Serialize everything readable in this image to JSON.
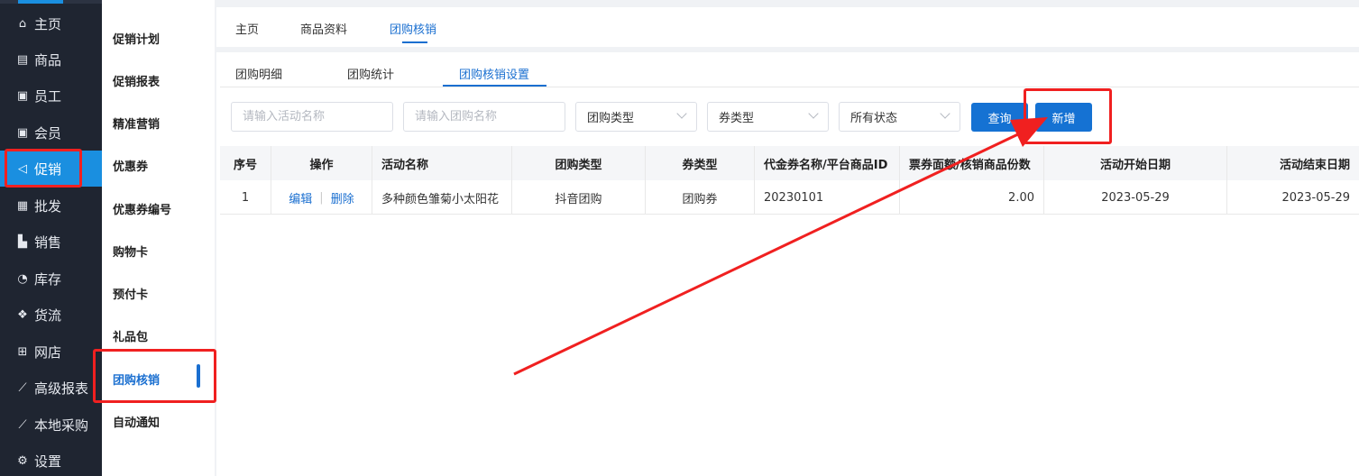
{
  "main_nav": {
    "items": [
      {
        "icon": "home-icon",
        "glyph": "⌂",
        "label": "主页"
      },
      {
        "icon": "product-icon",
        "glyph": "▤",
        "label": "商品"
      },
      {
        "icon": "staff-icon",
        "glyph": "▣",
        "label": "员工"
      },
      {
        "icon": "member-icon",
        "glyph": "▣",
        "label": "会员"
      },
      {
        "icon": "promotion-icon",
        "glyph": "◁",
        "label": "促销"
      },
      {
        "icon": "wholesale-icon",
        "glyph": "▦",
        "label": "批发"
      },
      {
        "icon": "sales-icon",
        "glyph": "▙",
        "label": "销售"
      },
      {
        "icon": "inventory-icon",
        "glyph": "◔",
        "label": "库存"
      },
      {
        "icon": "logistics-icon",
        "glyph": "❖",
        "label": "货流"
      },
      {
        "icon": "shop-icon",
        "glyph": "⊞",
        "label": "网店"
      },
      {
        "icon": "advanced-report-icon",
        "glyph": "⟋",
        "label": "高级报表"
      },
      {
        "icon": "local-purchase-icon",
        "glyph": "⟋",
        "label": "本地采购"
      },
      {
        "icon": "settings-icon",
        "glyph": "⚙",
        "label": "设置"
      }
    ],
    "active": "促销"
  },
  "sub_nav": {
    "items": [
      "促销计划",
      "促销报表",
      "精准营销",
      "优惠券",
      "优惠券编号",
      "购物卡",
      "预付卡",
      "礼品包",
      "团购核销",
      "自动通知"
    ],
    "active": "团购核销"
  },
  "top_tabs": [
    "主页",
    "商品资料",
    "团购核销"
  ],
  "sub_tabs": [
    "团购明细",
    "团购统计",
    "团购核销设置"
  ],
  "filters": {
    "activity_name_placeholder": "请输入活动名称",
    "groupbuy_name_placeholder": "请输入团购名称",
    "groupbuy_type": "团购类型",
    "coupon_type": "券类型",
    "status": "所有状态",
    "query_label": "查询",
    "add_label": "新增"
  },
  "table": {
    "headers": [
      "序号",
      "操作",
      "活动名称",
      "团购类型",
      "券类型",
      "代金券名称/平台商品ID",
      "票券面额/核销商品份数",
      "活动开始日期",
      "活动结束日期"
    ],
    "rows": [
      {
        "index": "1",
        "edit": "编辑",
        "delete": "删除",
        "activity_name": "多种颜色雏菊小太阳花",
        "groupbuy_type": "抖音团购",
        "coupon_type": "团购券",
        "coupon_id": "20230101",
        "face_value": "2.00",
        "start_date": "2023-05-29",
        "end_date": "2023-05-29"
      }
    ]
  },
  "colors": {
    "sidebar_bg": "#1f2531",
    "accent": "#1a6fd0",
    "primary_button": "#1572d3",
    "annotation_red": "#f02020"
  }
}
